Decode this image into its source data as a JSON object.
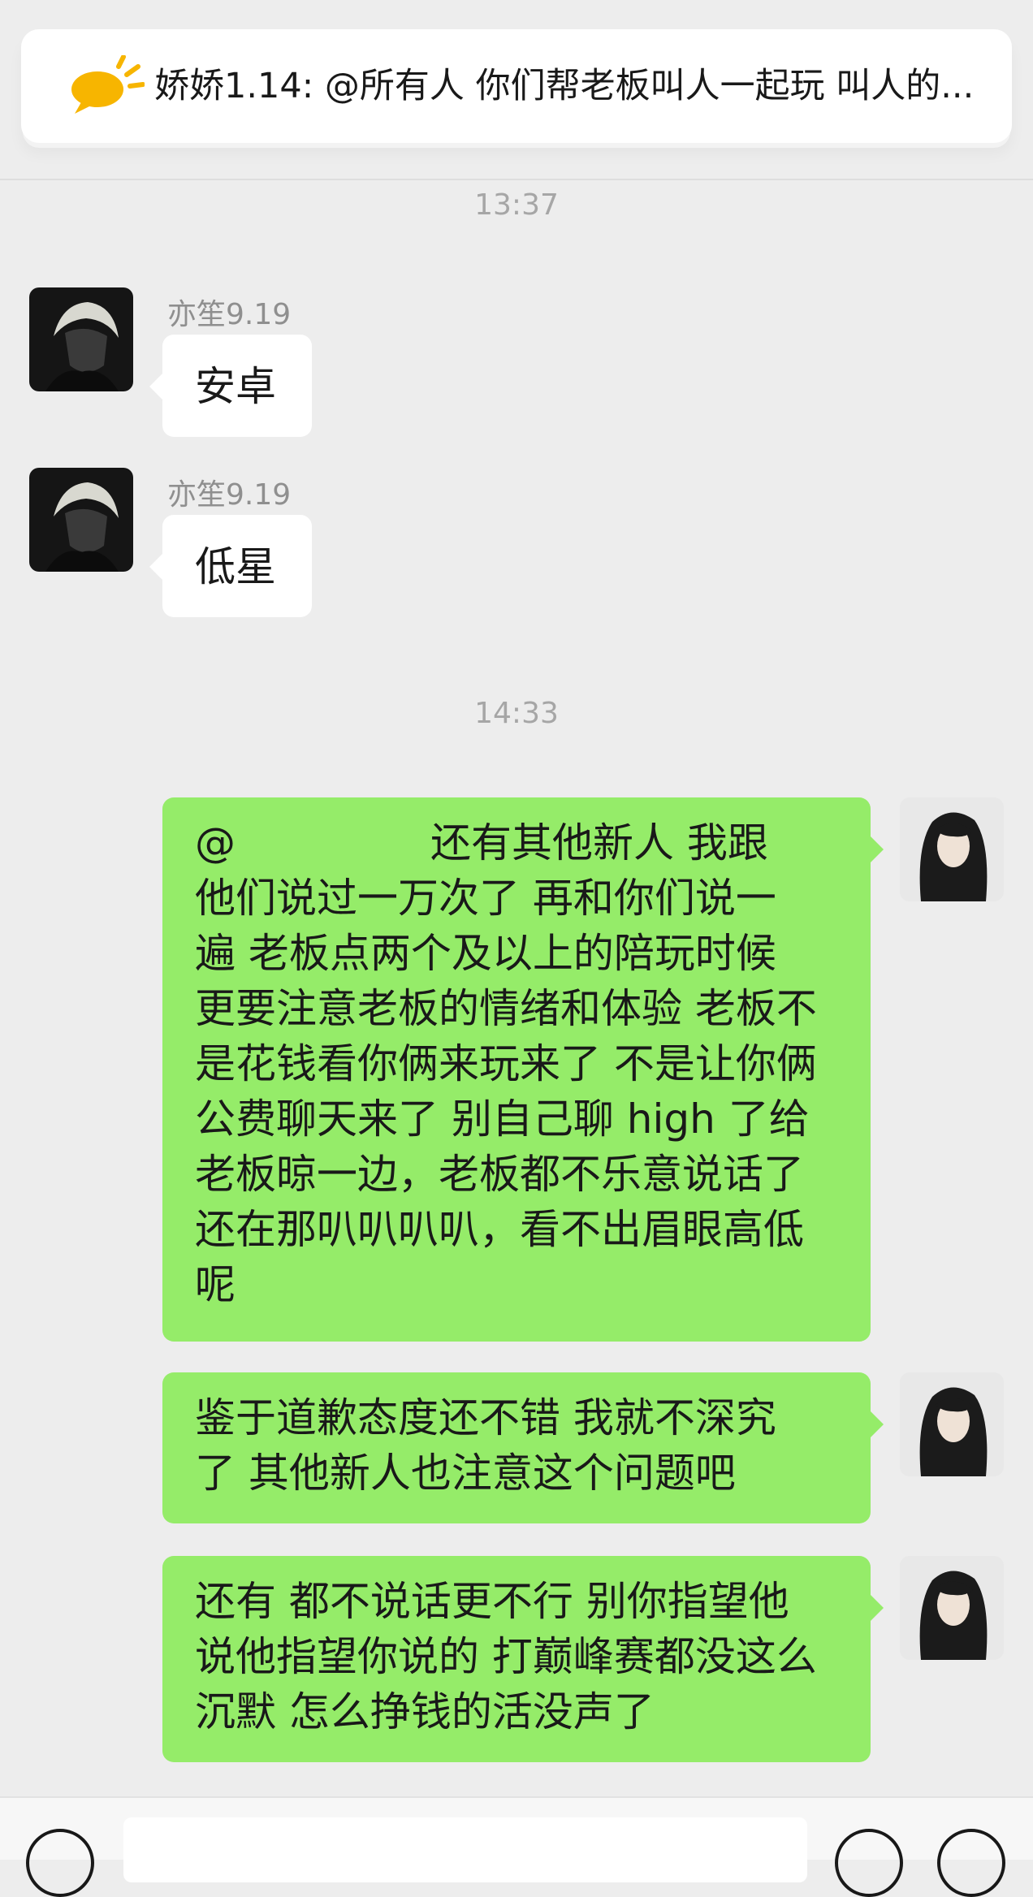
{
  "pinned": {
    "icon": "announcement-megaphone-icon",
    "text": "娇娇1.14: @所有人 你们帮老板叫人一起玩 叫人的..."
  },
  "timestamps": [
    "13:37",
    "14:33"
  ],
  "incoming": [
    {
      "sender": "亦笙9.19",
      "text": "安卓",
      "avatar": "avatar-white-hair"
    },
    {
      "sender": "亦笙9.19",
      "text": "低星",
      "avatar": "avatar-white-hair"
    }
  ],
  "outgoing": [
    {
      "mention": "@",
      "lines": [
        "还有其他新人 我跟",
        "他们说过一万次了 再和你们说一",
        "遍 老板点两个及以上的陪玩时候",
        "更要注意老板的情绪和体验 老板不",
        "是花钱看你俩来玩来了 不是让你俩",
        "公费聊天来了  别自己聊 high 了给",
        "老板晾一边，老板都不乐意说话了",
        "还在那叭叭叭叭，看不出眉眼高低",
        "呢"
      ],
      "avatar": "avatar-black-hair"
    },
    {
      "lines": [
        "鉴于道歉态度还不错 我就不深究",
        "了 其他新人也注意这个问题吧"
      ],
      "avatar": "avatar-black-hair"
    },
    {
      "lines": [
        "还有 都不说话更不行 别你指望他",
        "说他指望你说的 打巅峰赛都没这么",
        "沉默 怎么挣钱的活没声了"
      ],
      "avatar": "avatar-black-hair"
    }
  ],
  "colors": {
    "background": "#ededed",
    "outgoing_bubble": "#95ec69",
    "incoming_bubble": "#ffffff",
    "announcement_icon": "#f7b500"
  }
}
